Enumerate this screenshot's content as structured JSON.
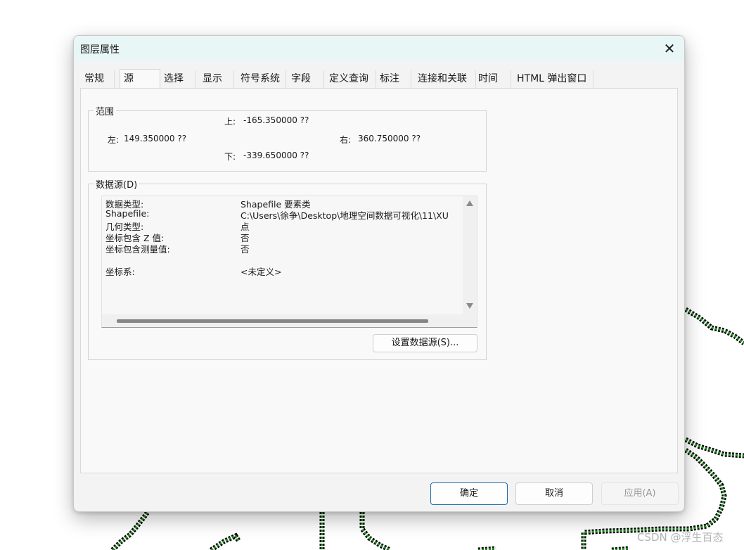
{
  "dialog": {
    "title": "图层属性",
    "close_icon": "close-icon"
  },
  "tabs": [
    {
      "label": "常规",
      "active": false
    },
    {
      "label": "源",
      "active": true
    },
    {
      "label": "选择",
      "active": false
    },
    {
      "label": "显示",
      "active": false
    },
    {
      "label": "符号系统",
      "active": false
    },
    {
      "label": "字段",
      "active": false
    },
    {
      "label": "定义查询",
      "active": false
    },
    {
      "label": "标注",
      "active": false
    },
    {
      "label": "连接和关联",
      "active": false
    },
    {
      "label": "时间",
      "active": false
    },
    {
      "label": "HTML 弹出窗口",
      "active": false
    }
  ],
  "extent": {
    "title": "范围",
    "top_label": "上:",
    "top_value": "-165.350000 ??",
    "left_label": "左:",
    "left_value": "149.350000 ??",
    "right_label": "右:",
    "right_value": "360.750000 ??",
    "bottom_label": "下:",
    "bottom_value": "-339.650000 ??"
  },
  "datasource": {
    "title": "数据源(D)",
    "rows": [
      {
        "key": "数据类型:",
        "value": "Shapefile 要素类"
      },
      {
        "key": "Shapefile:",
        "value": "C:\\Users\\徐争\\Desktop\\地理空间数据可视化\\11\\XU"
      },
      {
        "key": "几何类型:",
        "value": "点"
      },
      {
        "key": "坐标包含 Z 值:",
        "value": "否"
      },
      {
        "key": "坐标包含测量值:",
        "value": "否"
      },
      {
        "key": "",
        "value": ""
      },
      {
        "key": "坐标系:",
        "value": "<未定义>"
      }
    ],
    "set_source_button": "设置数据源(S)..."
  },
  "buttons": {
    "ok": "确定",
    "cancel": "取消",
    "apply": "应用(A)"
  },
  "watermark": "CSDN @浮生百态",
  "colors": {
    "title_bar": "#e8f6f6",
    "map_line": "#2e8b2e",
    "map_outline": "#000000",
    "primary_border": "#1f6ca8"
  }
}
